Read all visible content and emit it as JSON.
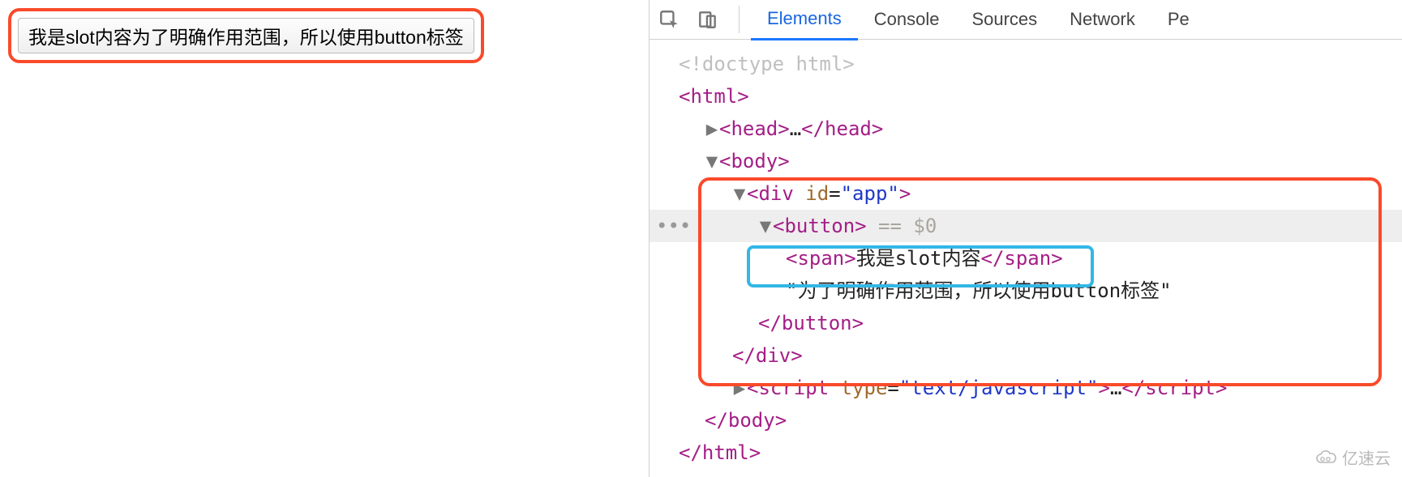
{
  "page": {
    "button_text": "我是slot内容为了明确作用范围，所以使用button标签"
  },
  "devtools": {
    "tabs": {
      "elements": "Elements",
      "console": "Console",
      "sources": "Sources",
      "network": "Network",
      "overflow_initial": "Pe"
    },
    "dom": {
      "doctype": "<!doctype html>",
      "html_open": "<html>",
      "head_open": "<head>",
      "head_ellipsis": "…",
      "head_close": "</head>",
      "body_open": "<body>",
      "div_open_1": "<div ",
      "div_attr_id": "id",
      "div_eq": "=",
      "div_attr_val": "\"app\"",
      "div_open_2": ">",
      "button_open": "<button>",
      "selected_marker": " == $0",
      "span_open": "<span>",
      "span_text": "我是slot内容",
      "span_close": "</span>",
      "button_text_node": "\"为了明确作用范围，所以使用button标签\"",
      "button_close": "</button>",
      "div_close": "</div>",
      "script_open_1": "<script ",
      "script_attr_type": "type",
      "script_eq": "=",
      "script_attr_val": "\"text/javascript\"",
      "script_open_2": ">",
      "script_ellipsis": "…",
      "script_close": "</script>",
      "body_close": "</body>",
      "html_close": "</html>"
    }
  },
  "watermark": {
    "text": "亿速云"
  },
  "colors": {
    "highlight_red": "#f94a2b",
    "highlight_cyan": "#33b7e5",
    "tab_active_blue": "#1a78ff",
    "tag_purple": "#a41e86",
    "attr_brown": "#a06a2c",
    "string_blue": "#2038c7"
  }
}
